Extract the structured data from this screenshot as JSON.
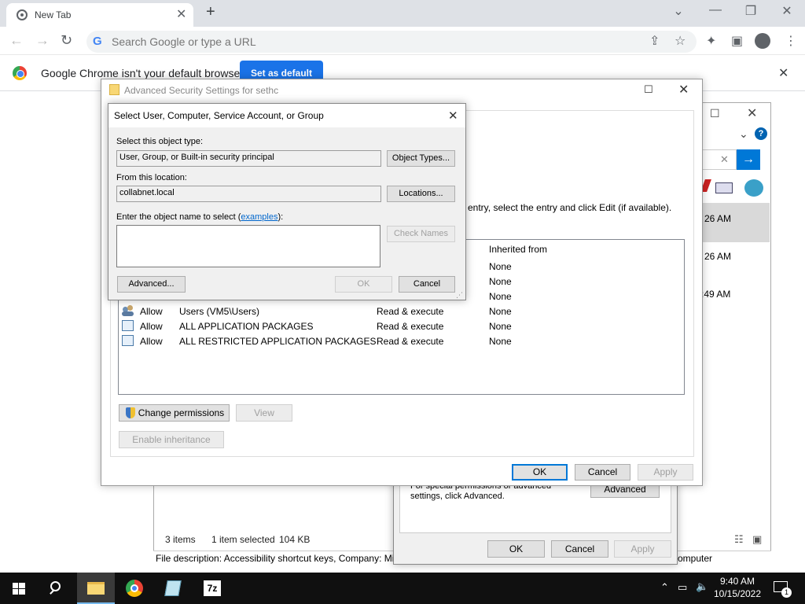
{
  "browser": {
    "tab_title": "New Tab",
    "omnibox_placeholder": "Search Google or type a URL",
    "infobar_text": "Google Chrome isn't your default browser",
    "infobar_button": "Set as default"
  },
  "adv_window": {
    "title": "Advanced Security Settings for sethc",
    "partial_text": "entry, select the entry and click Edit (if available).",
    "list_header_inherited": "Inherited from",
    "rows": [
      {
        "type": "",
        "principal": "",
        "access": "",
        "inherited": "None"
      },
      {
        "type": "",
        "principal": "",
        "access": "",
        "inherited": "None"
      },
      {
        "type": "",
        "principal": "",
        "access": "",
        "inherited": "None"
      },
      {
        "type": "Allow",
        "principal": "Users (VM5\\Users)",
        "access": "Read & execute",
        "inherited": "None"
      },
      {
        "type": "Allow",
        "principal": "ALL APPLICATION PACKAGES",
        "access": "Read & execute",
        "inherited": "None"
      },
      {
        "type": "Allow",
        "principal": "ALL RESTRICTED APPLICATION PACKAGES",
        "access": "Read & execute",
        "inherited": "None"
      }
    ],
    "change_permissions": "Change permissions",
    "view": "View",
    "enable_inheritance": "Enable inheritance",
    "ok": "OK",
    "cancel": "Cancel",
    "apply": "Apply"
  },
  "select_dialog": {
    "title": "Select User, Computer, Service Account, or Group",
    "object_type_label": "Select this object type:",
    "object_type_value": "User, Group, or Built-in security principal",
    "object_types_btn": "Object Types...",
    "location_label": "From this location:",
    "location_value": "collabnet.local",
    "locations_btn": "Locations...",
    "enter_name_label_pre": "Enter the object name to select (",
    "examples_link": "examples",
    "enter_name_label_post": "):",
    "check_names_btn": "Check Names",
    "advanced_btn": "Advanced...",
    "ok": "OK",
    "cancel": "Cancel"
  },
  "explorer": {
    "times": [
      "26 AM",
      "26 AM",
      ":49 AM"
    ],
    "status_items": "3 items",
    "status_selected": "1 item selected",
    "status_size": "104 KB",
    "file_description": "File description: Accessibility shortcut keys, Company: Mi",
    "computer_text": "omputer"
  },
  "properties": {
    "special_text": "For special permissions or advanced settings, click Advanced.",
    "advanced_btn": "Advanced",
    "ok": "OK",
    "cancel": "Cancel",
    "apply": "Apply"
  },
  "taskbar": {
    "time": "9:40 AM",
    "date": "10/15/2022",
    "notification_count": "1"
  }
}
